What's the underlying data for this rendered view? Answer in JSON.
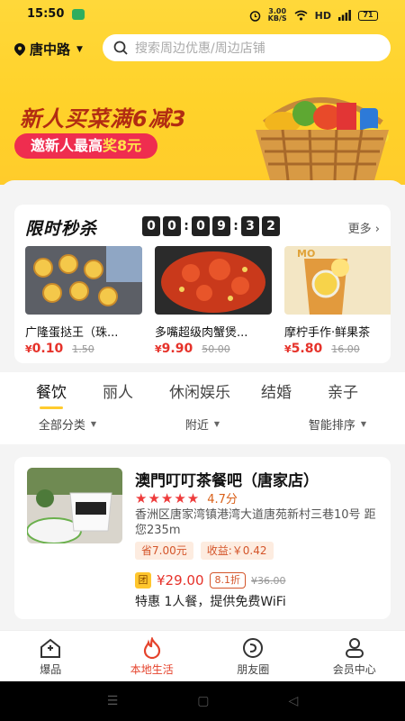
{
  "status_bar": {
    "time": "15:50",
    "net_rate": "3.00",
    "net_unit": "KB/S",
    "hd": "HD",
    "battery": "71"
  },
  "header": {
    "location": "唐中路",
    "search_placeholder": "搜索周边优惠/周边店铺"
  },
  "banner": {
    "headline": "新人买菜满6减3",
    "pill_prefix": "邀新人最高",
    "pill_highlight": "奖8元"
  },
  "flash_sale": {
    "title": "限时秒杀",
    "timer_digits": [
      "0",
      "0",
      "0",
      "9",
      "3",
      "2"
    ],
    "more": "更多",
    "products": [
      {
        "name": "广隆蛋挞王（珠...",
        "currency": "¥",
        "price": "0.10",
        "original": "1.50"
      },
      {
        "name": "多嘴超级肉蟹煲...",
        "currency": "¥",
        "price": "9.90",
        "original": "50.00"
      },
      {
        "name": "摩柠手作·鲜果茶",
        "currency": "¥",
        "price": "5.80",
        "original": "16.00"
      }
    ]
  },
  "categories": {
    "tabs": [
      "餐饮",
      "丽人",
      "休闲娱乐",
      "结婚",
      "亲子"
    ],
    "active_index": 0,
    "filters": [
      "全部分类",
      "附近",
      "智能排序"
    ]
  },
  "store": {
    "name": "澳門叮叮茶餐吧（唐家店）",
    "stars": "★★★★★",
    "score": "4.7分",
    "address": "香洲区唐家湾镇港湾大道唐苑新村三巷10号  距您235m",
    "tags": [
      "省7.00元",
      "收益:￥0.42"
    ],
    "deal_badge": "团",
    "deal_price": "¥29.00",
    "discount": "8.1折",
    "original": "¥36.00",
    "description": "特惠 1人餐，提供免费WiFi"
  },
  "bottom_nav": {
    "items": [
      "爆品",
      "本地生活",
      "朋友圈",
      "会员中心"
    ],
    "active_index": 1
  },
  "colors": {
    "brand_yellow": "#ffd22a",
    "accent_red": "#e6322a",
    "nav_active": "#e5422b"
  }
}
